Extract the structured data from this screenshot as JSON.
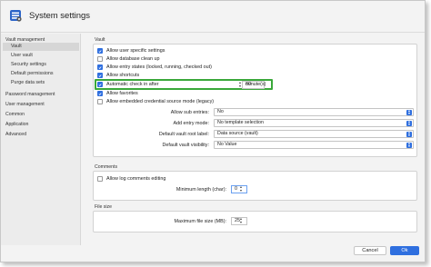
{
  "window": {
    "title": "System settings"
  },
  "sidebar": {
    "sections": [
      {
        "label": "Vault management",
        "items": [
          "Vault",
          "User vault",
          "Security settings",
          "Default permissions",
          "Purge data sets"
        ]
      },
      {
        "label": "Password management",
        "items": []
      },
      {
        "label": "User management",
        "items": []
      },
      {
        "label": "Common",
        "items": []
      },
      {
        "label": "Application",
        "items": []
      },
      {
        "label": "Advanced",
        "items": []
      }
    ],
    "selected": "Vault"
  },
  "vault": {
    "group_label": "Vault",
    "checkboxes": [
      {
        "label": "Allow user specific settings",
        "checked": true
      },
      {
        "label": "Allow database clean up",
        "checked": false
      },
      {
        "label": "Allow entry states (locked, running, checked out)",
        "checked": true
      },
      {
        "label": "Allow shortcuts",
        "checked": true
      },
      {
        "label": "Automatic check in after",
        "checked": true
      },
      {
        "label": "Allow favorites",
        "checked": true
      },
      {
        "label": "Allow embedded credential source mode (legacy)",
        "checked": false
      }
    ],
    "checkin_value": "60",
    "checkin_unit": "minute(s)",
    "fields": [
      {
        "label": "Allow sub entries:",
        "value": "No"
      },
      {
        "label": "Add entry mode:",
        "value": "No template selection"
      },
      {
        "label": "Default vault root label:",
        "value": "Data source (vault)"
      },
      {
        "label": "Default vault visibility:",
        "value": "No Value"
      }
    ]
  },
  "comments": {
    "group_label": "Comments",
    "checkbox": {
      "label": "Allow log comments editing",
      "checked": false
    },
    "min_length_label": "Minimum length (char):",
    "min_length_value": "0"
  },
  "filesize": {
    "group_label": "File size",
    "max_label": "Maximum file size (MB):",
    "max_value": "25"
  },
  "footer": {
    "cancel_label": "Cancel",
    "ok_label": "Ok"
  },
  "colors": {
    "accent": "#2f6fdf",
    "highlight": "#3aa83a",
    "sidebar_bg": "#ececec",
    "selected_item": "#d6d6d6"
  },
  "icons": {
    "app": "settings-app-icon",
    "checkmark": "checkmark-icon",
    "select": "up-down-chevron-icon"
  }
}
